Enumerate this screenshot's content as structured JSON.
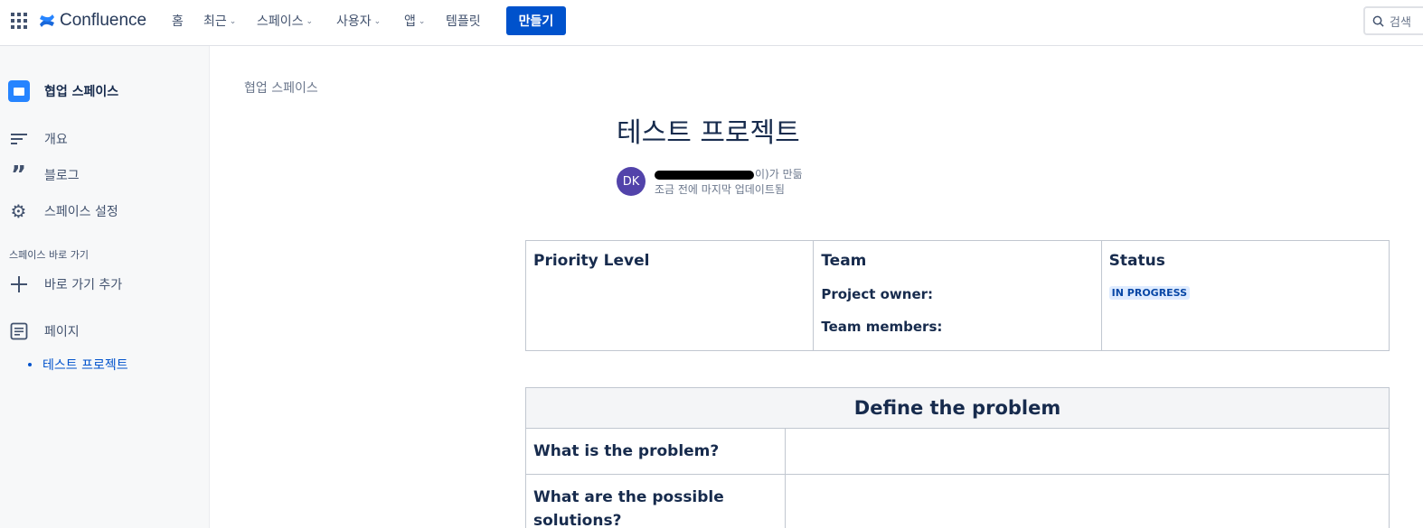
{
  "app": {
    "name": "Confluence"
  },
  "nav": {
    "home": "홈",
    "recent": "최근",
    "spaces": "스페이스",
    "people": "사용자",
    "apps": "앱",
    "templates": "템플릿",
    "create": "만들기",
    "search_placeholder": "검색"
  },
  "sidebar": {
    "space_name": "협업 스페이스",
    "items": [
      {
        "label": "개요",
        "icon": "overview-icon"
      },
      {
        "label": "블로그",
        "icon": "quote-icon"
      },
      {
        "label": "스페이스 설정",
        "icon": "gear-icon"
      }
    ],
    "shortcuts_heading": "스페이스 바로 가기",
    "add_shortcut": "바로 가기 추가",
    "pages_label": "페이지",
    "current_page": "테스트 프로젝트"
  },
  "page": {
    "breadcrumb": "협업 스페이스",
    "title": "테스트 프로젝트",
    "avatar_initials": "DK",
    "created_by_suffix": "이)가 만듦",
    "updated": "조금 전에 마지막 업데이트됨"
  },
  "info_table": {
    "priority": "Priority Level",
    "team": "Team",
    "project_owner": "Project owner:",
    "team_members": "Team members:",
    "status": "Status",
    "status_badge": "IN PROGRESS"
  },
  "problem_table": {
    "heading": "Define the problem",
    "q1": "What is the problem?",
    "q2": "What are the possible solutions?"
  }
}
